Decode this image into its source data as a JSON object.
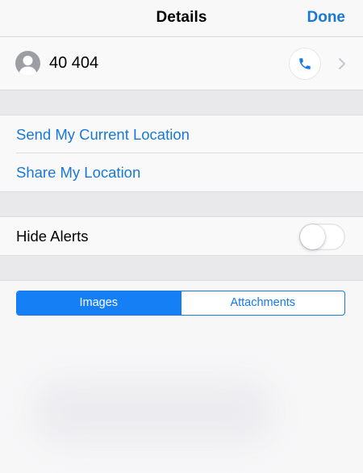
{
  "navbar": {
    "title": "Details",
    "done_label": "Done"
  },
  "contact": {
    "name": "40 404",
    "avatar_icon": "person-silhouette-icon",
    "call_icon": "phone-icon",
    "disclosure_icon": "chevron-right-icon"
  },
  "location": {
    "send_current_label": "Send My Current Location",
    "share_label": "Share My Location"
  },
  "alerts": {
    "hide_label": "Hide Alerts",
    "hide_enabled": false
  },
  "segments": {
    "items": [
      "Images",
      "Attachments"
    ],
    "selected": "Images"
  },
  "colors": {
    "accent": "#1979d2",
    "segment_selected": "#1580f5",
    "group_gap": "#e9e9eb",
    "cell_background": "#f9f9fa"
  }
}
